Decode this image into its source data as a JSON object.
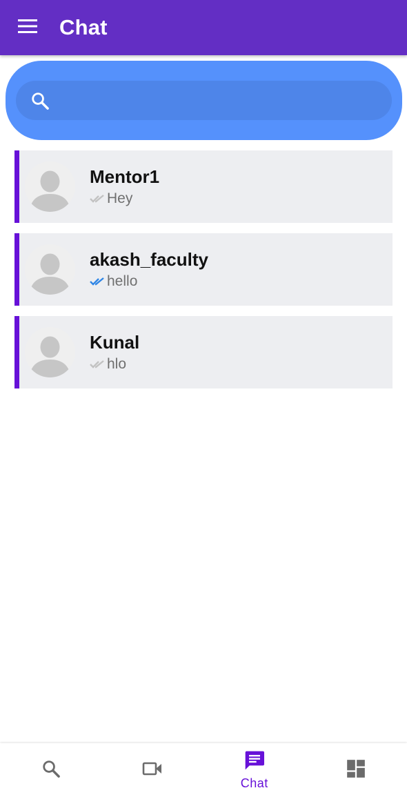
{
  "appbar": {
    "title": "Chat",
    "background": "#632ec4",
    "menu_icon": "menu-icon"
  },
  "search": {
    "placeholder": "",
    "icon": "search-icon",
    "outer_color": "#5591fc",
    "inner_color": "#4e85e9"
  },
  "chats": [
    {
      "name": "Mentor1",
      "last_message": "Hey",
      "status": "delivered",
      "tick_color": "#c2c2c2"
    },
    {
      "name": "akash_faculty",
      "last_message": "hello",
      "status": "read",
      "tick_color": "#2f86e6"
    },
    {
      "name": "Kunal",
      "last_message": "hlo",
      "status": "delivered",
      "tick_color": "#c2c2c2"
    }
  ],
  "accent_color": "#6711d8",
  "bottom_nav": {
    "items": [
      {
        "icon": "search-icon",
        "label": "",
        "active": false
      },
      {
        "icon": "video-camera-icon",
        "label": "",
        "active": false
      },
      {
        "icon": "chat-icon",
        "label": "Chat",
        "active": true
      },
      {
        "icon": "dashboard-icon",
        "label": "",
        "active": false
      }
    ],
    "active_color": "#6711d8",
    "inactive_color": "#6b6b6b"
  }
}
